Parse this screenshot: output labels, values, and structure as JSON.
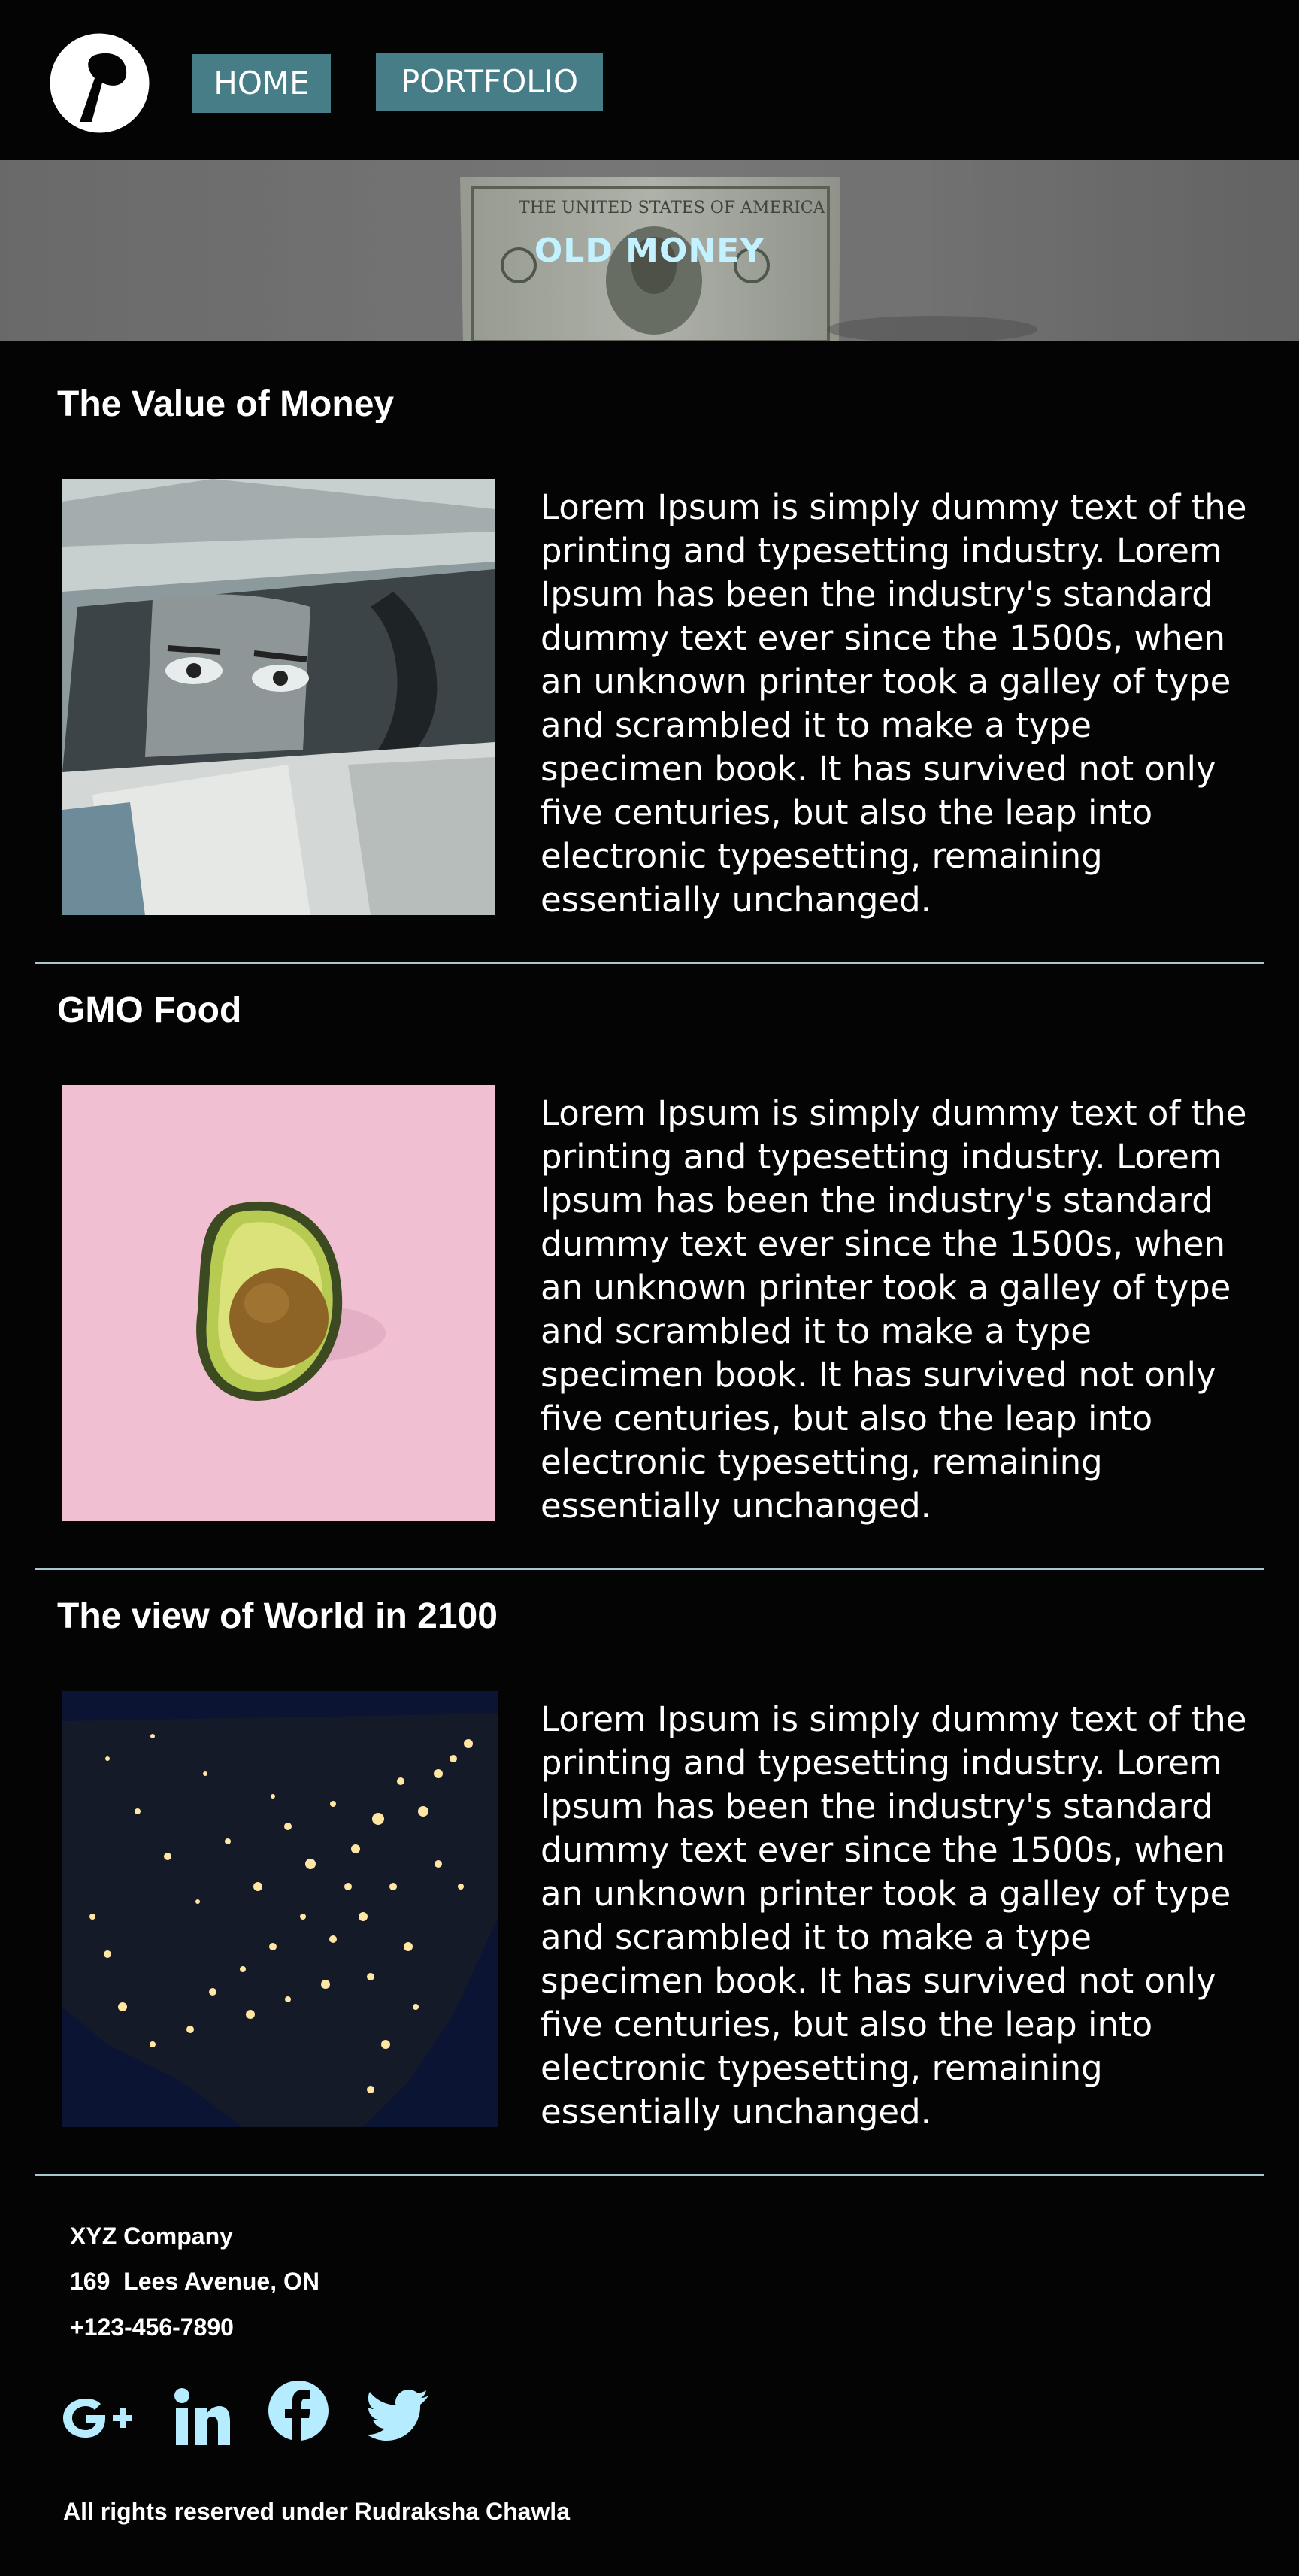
{
  "header": {
    "logo_icon": "dot-logo-icon",
    "nav": [
      {
        "label": "HOME"
      },
      {
        "label": "PORTFOLIO"
      }
    ]
  },
  "banner": {
    "title": "OLD MONEY",
    "image": "dollar-bill-banner"
  },
  "articles": [
    {
      "title": "The Value of Money",
      "image": "banknote-portrait-image",
      "text": "Lorem Ipsum is simply dummy text of the printing and typesetting industry. Lorem Ipsum has been the industry's standard dummy text ever since the 1500s, when an unknown printer took a galley of type and scrambled it to make a type specimen book. It has survived not only five centuries, but also the leap into electronic typesetting, remaining essentially unchanged."
    },
    {
      "title": "GMO Food",
      "image": "avocado-image",
      "text": "Lorem Ipsum is simply dummy text of the printing and typesetting industry. Lorem Ipsum has been the industry's standard dummy text ever since the 1500s, when an unknown printer took a galley of type and scrambled it to make a type specimen book. It has survived not only five centuries, but also the leap into electronic typesetting, remaining essentially unchanged."
    },
    {
      "title": "The view of World in 2100",
      "image": "night-map-image",
      "text": "Lorem Ipsum is simply dummy text of the printing and typesetting industry. Lorem Ipsum has been the industry's standard dummy text ever since the 1500s, when an unknown printer took a galley of type and scrambled it to make a type specimen book. It has survived not only five centuries, but also the leap into electronic typesetting, remaining essentially unchanged."
    }
  ],
  "footer": {
    "company": "XYZ Company",
    "address": "169  Lees Avenue, ON",
    "phone": "+123-456-7890",
    "social": [
      {
        "icon": "google-plus-icon"
      },
      {
        "icon": "linkedin-icon"
      },
      {
        "icon": "facebook-icon"
      },
      {
        "icon": "twitter-icon"
      }
    ],
    "copyright": "All rights reserved under Rudraksha Chawla"
  },
  "colors": {
    "background": "#040404",
    "nav_button": "#477d87",
    "accent": "#c2f1ff",
    "icon": "#b6ecff",
    "divider": "#a9c7d0"
  }
}
